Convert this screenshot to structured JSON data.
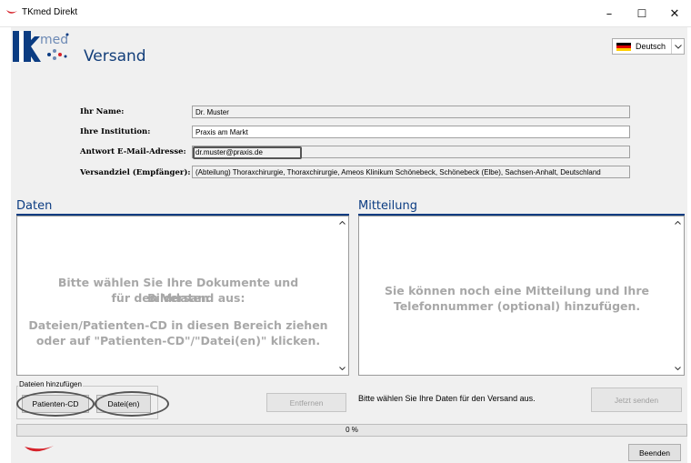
{
  "window": {
    "title": "TKmed Direkt",
    "minimize": "–",
    "maximize": "☐",
    "close": "✕"
  },
  "header": {
    "logo_text": "med",
    "title": "Versand"
  },
  "language": {
    "selected": "Deutsch"
  },
  "form": {
    "name_label": "Ihr Name:",
    "name_value": "Dr. Muster",
    "institution_label": "Ihre Institution:",
    "institution_value": "Praxis am Markt",
    "email_label": "Antwort E-Mail-Adresse:",
    "email_value": "dr.muster@praxis.de",
    "target_label": "Versandziel (Empfänger):",
    "target_value": "(Abteilung) Thoraxchirurgie, Thoraxchirurgie, Ameos Klinikum Schönebeck, Schönebeck (Elbe), Sachsen-Anhalt, Deutschland"
  },
  "data_section": {
    "title": "Daten",
    "hint_line1": "Bitte wählen Sie Ihre Dokumente und Bilddaten",
    "hint_line2": "für den Versand aus:",
    "hint_line3": "Dateien/Patienten-CD in diesen Bereich ziehen",
    "hint_line4": "oder auf \"Patienten-CD\"/\"Datei(en)\" klicken."
  },
  "message_section": {
    "title": "Mitteilung",
    "hint_line1": "Sie können noch eine Mitteilung und Ihre",
    "hint_line2": "Telefonnummer (optional) hinzufügen."
  },
  "add_files": {
    "group_label": "Dateien hinzufügen",
    "patient_cd_label": "Patienten-CD",
    "files_label": "Datei(en)"
  },
  "remove_label": "Entfernen",
  "status_text": "Bitte wählen Sie Ihre Daten für den Versand aus.",
  "send_label": "Jetzt senden",
  "progress": {
    "value": 0,
    "label": "0 %"
  },
  "exit_label": "Beenden",
  "colors": {
    "brand_blue": "#0b3c82",
    "brand_red": "#d6222a",
    "panel_gray": "#f0f0f0"
  },
  "icons": {
    "app": "tkmed-swoosh-icon",
    "scroll_up": "chevron-up-icon",
    "scroll_down": "chevron-down-icon"
  }
}
